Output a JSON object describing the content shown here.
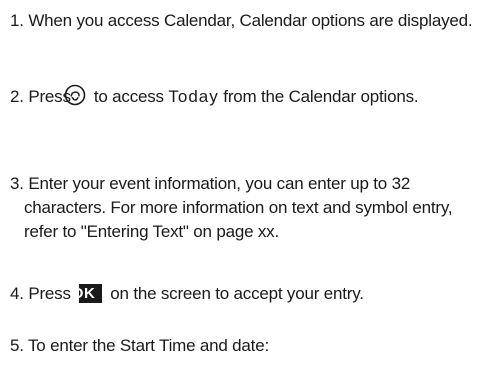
{
  "steps": [
    {
      "number": "1.",
      "text": "When you access Calendar, Calendar options are displayed."
    },
    {
      "number": "2.",
      "before": "Press",
      "icon": "center-select-key-icon",
      "after1": "to access",
      "keyword": "Today",
      "after2": "from the Calendar options."
    },
    {
      "number": "3.",
      "text": "Enter your event information, you can enter up to 32 characters. For more information on text and symbol entry, refer to \"Entering Text\" on page xx."
    },
    {
      "number": "4.",
      "before": "Press",
      "key": "OK",
      "after": "on the screen to accept your entry."
    },
    {
      "number": "5.",
      "text": "To enter the Start Time and date:"
    }
  ]
}
